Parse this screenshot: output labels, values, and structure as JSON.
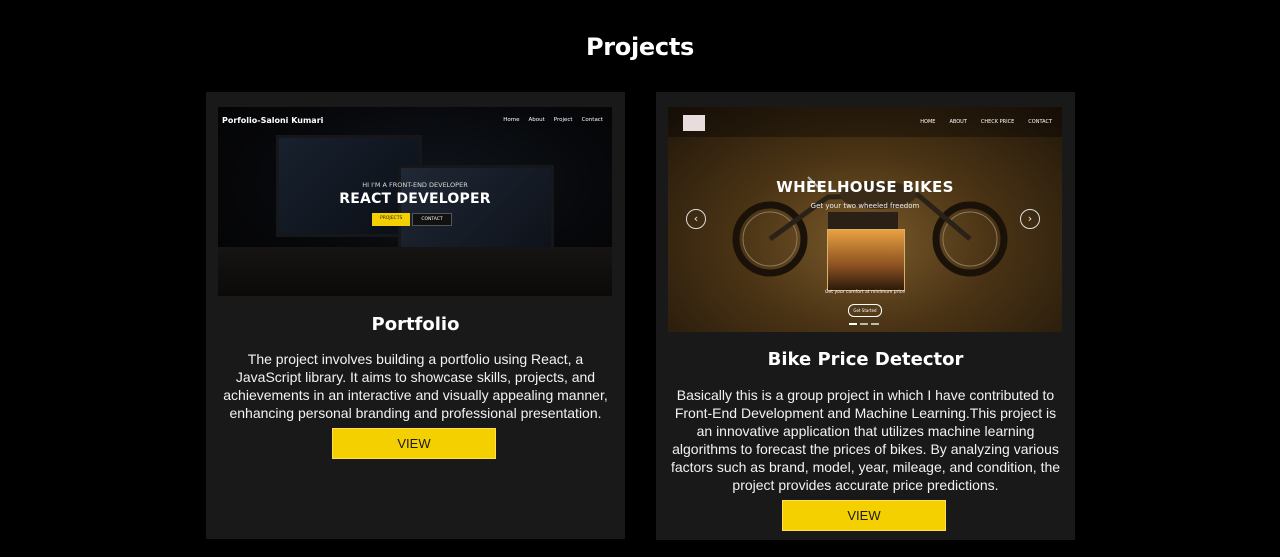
{
  "section": {
    "title": "Projects"
  },
  "projects": [
    {
      "title": "Portfolio",
      "description": "The project involves building a portfolio using React, a JavaScript library. It aims to showcase skills, projects, and achievements in an interactive and visually appealing manner, enhancing personal branding and professional presentation.",
      "button_label": "VIEW",
      "thumbnail": {
        "brand": "Porfolio-Saloni Kumari",
        "nav": [
          "Home",
          "About",
          "Project",
          "Contact"
        ],
        "subtitle": "HI I'M A FRONT-END DEVELOPER",
        "hero": "REACT DEVELOPER",
        "button_primary": "PROJECTS",
        "button_secondary": "CONTACT"
      }
    },
    {
      "title": "Bike Price Detector",
      "description": "Basically this is a group project in which I have contributed to Front-End Development and Machine Learning.This project is an innovative application that utilizes machine learning algorithms to forecast the prices of bikes. By analyzing various factors such as brand, model, year, mileage, and condition, the project provides accurate price predictions.",
      "button_label": "VIEW",
      "thumbnail": {
        "nav": [
          "HOME",
          "ABOUT",
          "CHECK PRICE",
          "CONTACT"
        ],
        "hero": "WHEELHOUSE BIKES",
        "subtitle": "Get your two wheeled freedom",
        "caption": "Get your comfort at minimum price",
        "cta": "Get Started",
        "prev_icon": "chevron-left-icon",
        "next_icon": "chevron-right-icon"
      }
    }
  ],
  "colors": {
    "background": "#000000",
    "card": "#1a1919",
    "button": "#f5d000"
  }
}
